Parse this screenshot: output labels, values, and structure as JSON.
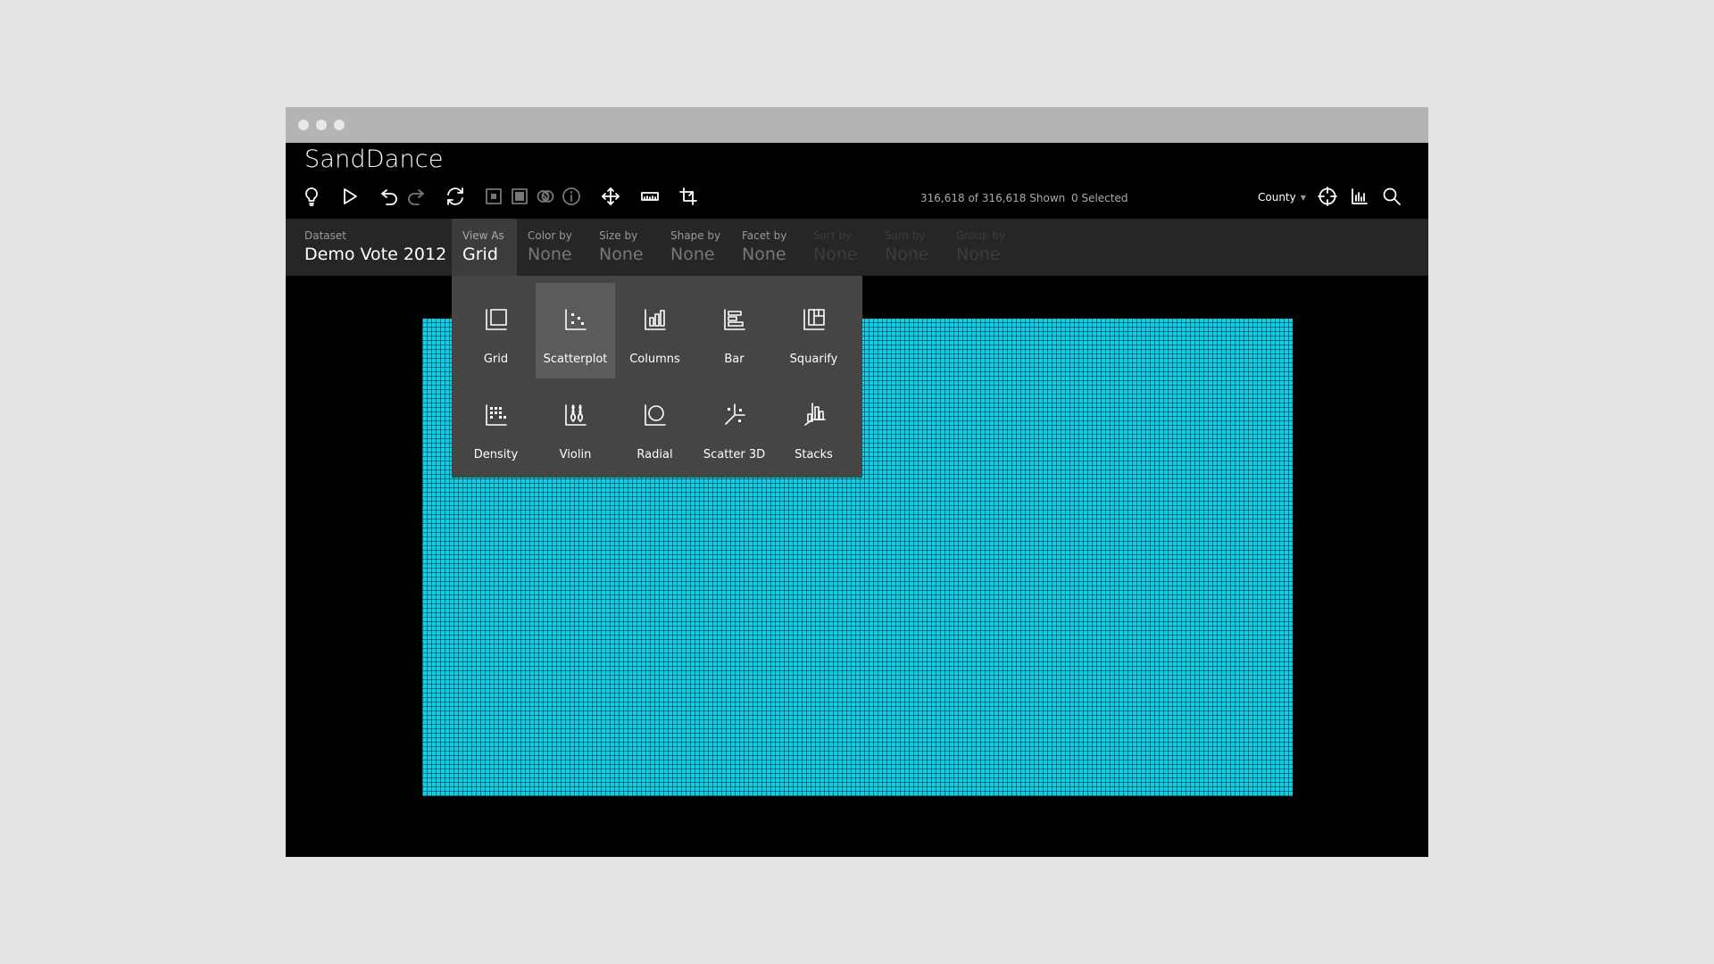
{
  "app": {
    "title": "SandDance"
  },
  "status": {
    "shown": "316,618 of 316,618 Shown",
    "selected": "0 Selected"
  },
  "toolbar": {
    "county_select": "County"
  },
  "controls": [
    {
      "label": "Dataset",
      "value": "Demo Vote 2012"
    },
    {
      "label": "View As",
      "value": "Grid"
    },
    {
      "label": "Color by",
      "value": "None"
    },
    {
      "label": "Size by",
      "value": "None"
    },
    {
      "label": "Shape by",
      "value": "None"
    },
    {
      "label": "Facet by",
      "value": "None"
    },
    {
      "label": "Sort by",
      "value": "None"
    },
    {
      "label": "Sum by",
      "value": "None"
    },
    {
      "label": "Group by",
      "value": "None"
    }
  ],
  "view_options": [
    {
      "label": "Grid",
      "icon": "grid-icon"
    },
    {
      "label": "Scatterplot",
      "icon": "scatterplot-icon"
    },
    {
      "label": "Columns",
      "icon": "columns-icon"
    },
    {
      "label": "Bar",
      "icon": "bar-icon"
    },
    {
      "label": "Squarify",
      "icon": "squarify-icon"
    },
    {
      "label": "Density",
      "icon": "density-icon"
    },
    {
      "label": "Violin",
      "icon": "violin-icon"
    },
    {
      "label": "Radial",
      "icon": "radial-icon"
    },
    {
      "label": "Scatter 3D",
      "icon": "scatter-3d-icon"
    },
    {
      "label": "Stacks",
      "icon": "stacks-icon"
    }
  ],
  "colors": {
    "canvas": "#0dcfe6",
    "dropdown_bg": "#454545",
    "selected_option": "#5b5b5b",
    "controlbar": "#262626"
  }
}
